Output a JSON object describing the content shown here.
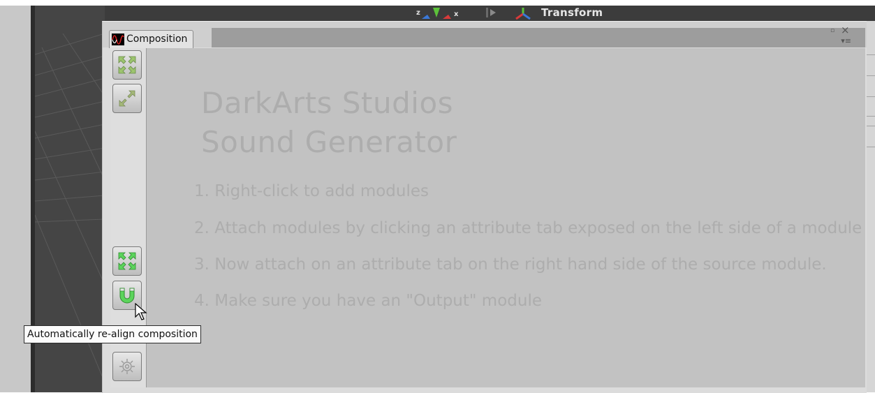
{
  "header": {
    "gizmo_axes": [
      "z",
      "x"
    ],
    "transform_label": "Transform"
  },
  "window": {
    "tab_label": "Composition",
    "tab_icon": "waveform-icon",
    "controls": {
      "maximize_icon": "▫",
      "close_icon": "×",
      "menu_icon": "▾≡"
    }
  },
  "toolbar": {
    "buttons": [
      {
        "name": "expand-all-button",
        "icon": "expand-arrows-icon"
      },
      {
        "name": "collapse-all-button",
        "icon": "collapse-arrows-icon"
      },
      {
        "name": "expand-button-green",
        "icon": "expand-arrows-green-icon"
      },
      {
        "name": "realign-composition-button",
        "icon": "magnet-icon"
      },
      {
        "name": "settings-button",
        "icon": "gear-icon"
      }
    ]
  },
  "canvas": {
    "title_line1": "DarkArts Studios",
    "title_line2": "Sound Generator",
    "instructions": [
      "1. Right-click to add modules",
      "2. Attach modules by clicking an attribute tab exposed on the left side of a module",
      "3. Now attach on an attribute tab on the right hand side of the source module.",
      "4. Make sure you have an \"Output\" module"
    ]
  },
  "tooltip": {
    "text": "Automatically re-align composition"
  },
  "colors": {
    "canvas_bg": "#c2c2c2",
    "watermark_text": "#adadad",
    "green_accent": "#5cd45c"
  }
}
